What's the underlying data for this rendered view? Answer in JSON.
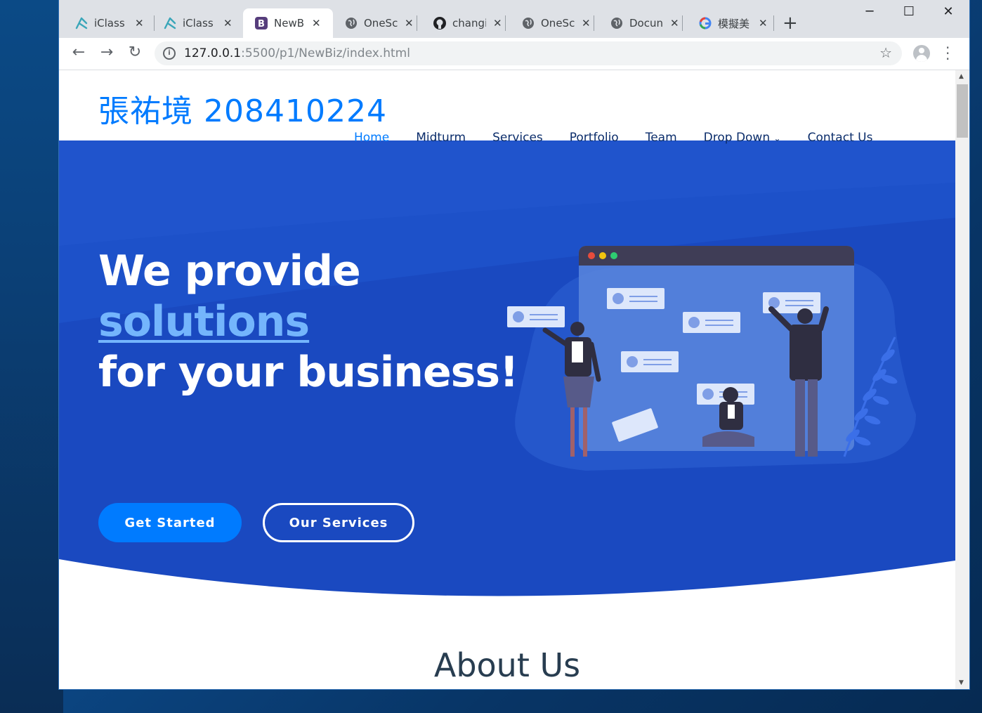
{
  "browser": {
    "tabs": [
      {
        "label": "iClass",
        "icon": "iclass-icon",
        "active": false
      },
      {
        "label": "iClass",
        "icon": "iclass-icon",
        "active": false
      },
      {
        "label": "NewBi",
        "icon": "bootstrap-icon",
        "active": true
      },
      {
        "label": "OneSc",
        "icon": "globe-icon",
        "active": false
      },
      {
        "label": "changi",
        "icon": "github-icon",
        "active": false
      },
      {
        "label": "OneSc",
        "icon": "globe-icon",
        "active": false
      },
      {
        "label": "Docun",
        "icon": "globe-icon",
        "active": false
      },
      {
        "label": "模擬美",
        "icon": "google-icon",
        "active": false
      }
    ],
    "url_host": "127.0.0.1",
    "url_path": ":5500/p1/NewBiz/index.html"
  },
  "site": {
    "logo": "張祐境 208410224",
    "nav": [
      "Home",
      "Midturm",
      "Services",
      "Portfolio",
      "Team",
      "Drop Down",
      "Contact Us"
    ],
    "hero": {
      "line1": "We provide",
      "accent": "solutions",
      "line3": "for your business!",
      "primary_button": "Get Started",
      "secondary_button": "Our Services"
    },
    "next_section_title": "About Us"
  },
  "colors": {
    "hero_blue": "#1a49c0",
    "link_blue": "#007bff",
    "accent_light": "#74b5fc"
  }
}
